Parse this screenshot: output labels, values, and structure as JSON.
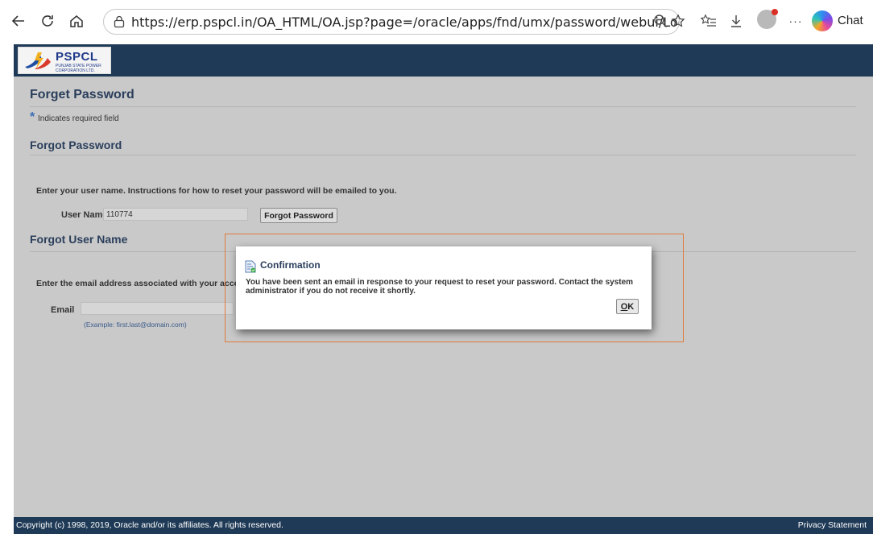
{
  "browser": {
    "url": "https://erp.pspcl.in/OA_HTML/OA.jsp?page=/oracle/apps/fnd/umx/password/webui/LoginHel...",
    "chat_label": "Chat",
    "icons": [
      "back-icon",
      "refresh-icon",
      "home-icon",
      "lock-icon",
      "zoom-icon",
      "favorite-icon",
      "favorites-list-icon",
      "download-icon",
      "more-icon",
      "copilot-icon"
    ]
  },
  "header": {
    "logo_text": "PSPCL",
    "logo_subtext": "PUNJAB STATE POWER CORPORATION LTD."
  },
  "page": {
    "title": "Forget Password",
    "required_star": "*",
    "required_note": "Indicates required field"
  },
  "forgot_password": {
    "title": "Forgot Password",
    "instruction": "Enter your user name. Instructions for how to reset your password will be emailed to you.",
    "username_label": "User Name",
    "username_value": "110774",
    "button_label": "Forgot Password"
  },
  "forgot_username": {
    "title": "Forgot User Name",
    "instruction": "Enter the email address associated with your accou",
    "email_label": "Email",
    "email_value": "",
    "email_hint": "(Example: first.last@domain.com)"
  },
  "dialog": {
    "title": "Confirmation",
    "message": "You have been sent an email in response to your request to reset your password. Contact the system administrator if you do not receive it shortly.",
    "ok_first": "O",
    "ok_rest": "K"
  },
  "footer": {
    "copyright": "Copyright (c) 1998, 2019, Oracle and/or its affiliates. All rights reserved.",
    "privacy": "Privacy Statement"
  },
  "colors": {
    "header_bg": "#1f3a56",
    "page_bg": "#c9c9c9",
    "dialog_outline": "#e07b3c",
    "title_text": "#2b3f5c"
  }
}
